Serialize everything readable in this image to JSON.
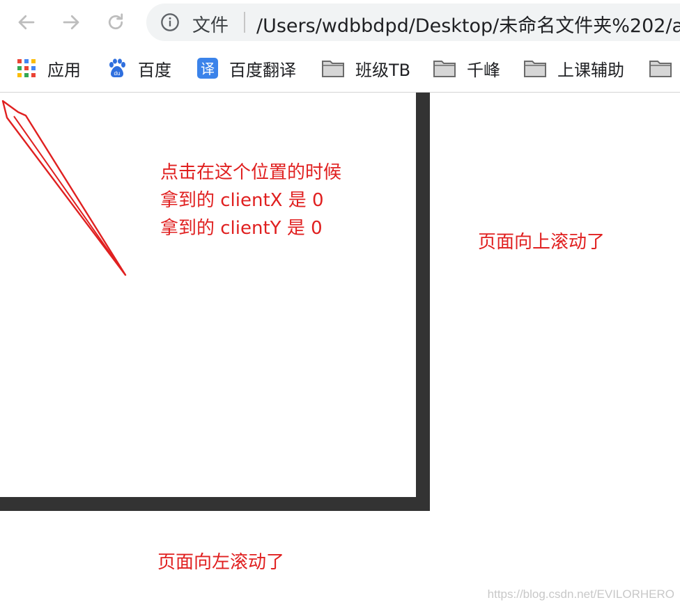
{
  "toolbar": {
    "back_icon": "back-arrow-icon",
    "forward_icon": "forward-arrow-icon",
    "reload_icon": "reload-icon",
    "omnibox": {
      "scheme_label": "文件",
      "url": "/Users/wdbbdpd/Desktop/未命名文件夹%202/a"
    }
  },
  "bookmarks": [
    {
      "label": "应用",
      "icon": "apps-grid-icon"
    },
    {
      "label": "百度",
      "icon": "baidu-paw-icon"
    },
    {
      "label": "百度翻译",
      "icon": "translate-icon",
      "icon_text": "译"
    },
    {
      "label": "班级TB",
      "icon": "folder-icon"
    },
    {
      "label": "千峰",
      "icon": "folder-icon"
    },
    {
      "label": "上课辅助",
      "icon": "folder-icon"
    },
    {
      "label": "",
      "icon": "folder-icon"
    }
  ],
  "annotations": {
    "click_note": [
      "点击在这个位置的时候",
      "拿到的 clientX 是 0",
      "拿到的 clientY 是 0"
    ],
    "scroll_up_note": "页面向上滚动了",
    "scroll_left_note": "页面向左滚动了"
  },
  "watermark": "https://blog.csdn.net/EVILORHERO",
  "colors": {
    "annotation_red": "#e02020",
    "box_border": "#333333",
    "omnibox_bg": "#f1f3f4"
  }
}
